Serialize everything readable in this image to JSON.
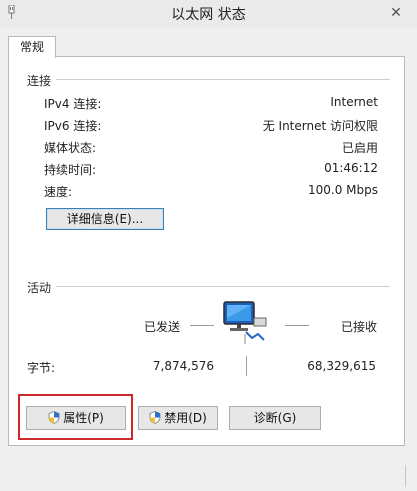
{
  "window": {
    "title": "以太网 状态",
    "close_glyph": "✕"
  },
  "tab": {
    "label": "常规"
  },
  "connection": {
    "title": "连接",
    "rows": [
      {
        "label": "IPv4 连接:",
        "value": "Internet"
      },
      {
        "label": "IPv6 连接:",
        "value": "无 Internet 访问权限"
      },
      {
        "label": "媒体状态:",
        "value": "已启用"
      },
      {
        "label": "持续时间:",
        "value": "01:46:12"
      },
      {
        "label": "速度:",
        "value": "100.0 Mbps"
      }
    ],
    "details_button": "详细信息(E)..."
  },
  "activity": {
    "title": "活动",
    "sent_label": "已发送",
    "received_label": "已接收",
    "bytes_label": "字节:",
    "bytes_sent": "7,874,576",
    "bytes_received": "68,329,615",
    "network_icon": "network-computer-icon"
  },
  "actions": {
    "properties": "属性(P)",
    "disable": "禁用(D)",
    "diagnose": "诊断(G)",
    "shield_icon": "uac-shield-icon"
  },
  "colors": {
    "highlight_box": "#cc2a2a",
    "focus_border": "#3c7fb1"
  }
}
